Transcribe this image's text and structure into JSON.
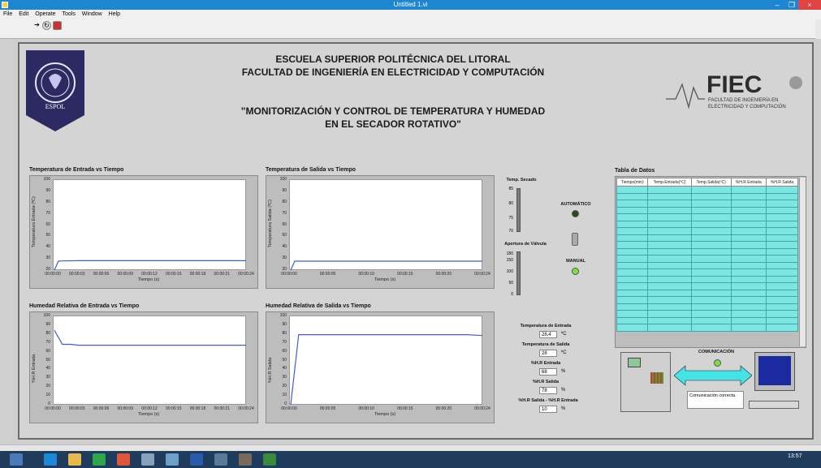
{
  "window": {
    "title": "Untitled 1.vi",
    "min": "–",
    "max": "❐",
    "close": "×"
  },
  "menu": [
    "File",
    "Edit",
    "Operate",
    "Tools",
    "Window",
    "Help"
  ],
  "header": {
    "line1": "ESCUELA SUPERIOR POLITÉCNICA DEL LITORAL",
    "line2": "FACULTAD DE INGENIERÍA EN ELECTRICIDAD Y COMPUTACIÓN",
    "line3": "\"MONITORIZACIÓN Y CONTROL DE TEMPERATURA Y HUMEDAD",
    "line4": "EN EL SECADOR ROTATIVO\""
  },
  "logo_right": {
    "brand": "FIEC",
    "sub1": "FACULTAD DE INGENIERÍA EN",
    "sub2": "ELECTRICIDAD Y COMPUTACIÓN"
  },
  "logo_left": {
    "label": "ESPOL"
  },
  "controls": {
    "temp_secado": "Temp. Secado",
    "apertura": "Apertura de Válvula",
    "automatico": "AUTOMÁTICO",
    "manual": "MANUAL",
    "temp_ticks": [
      "85",
      "80",
      "75",
      "70"
    ],
    "valve_ticks": [
      "180",
      "150",
      "100",
      "50",
      "0"
    ]
  },
  "indicators": {
    "t_entrada_label": "Temperatura de Entrada",
    "t_entrada": "28,4",
    "t_unit": "ºC",
    "t_salida_label": "Temperatura de Salida",
    "t_salida": "28",
    "hr_entrada_label": "%H.R Entrada",
    "hr_entrada": "68",
    "pct": "%",
    "hr_salida_label": "%H.R Salida",
    "hr_salida": "78",
    "diff_label": "%H.R Salida - %H.R Entrada",
    "diff": "10"
  },
  "table": {
    "title": "Tabla de Datos",
    "columns": [
      "Tiempo(min)",
      "Temp.Entrada(ºC)",
      "Temp.Salida(ºC)",
      "%H.R Entrada",
      "%H.R Salida"
    ]
  },
  "comm": {
    "label": "COMUNICACIÓN",
    "status": "Comunicación correcta"
  },
  "clock": {
    "time": "13:57"
  },
  "chart_data": [
    {
      "type": "line",
      "title": "Temperatura de Entrada vs Tiempo",
      "xlabel": "Tiempo (s)",
      "ylabel": "Temperatura Entrada (ºC)",
      "ylim": [
        20,
        100
      ],
      "yticks": [
        "100",
        "90",
        "80",
        "70",
        "60",
        "50",
        "40",
        "30",
        "20"
      ],
      "xticks": [
        "00:00:00",
        "00:00:03",
        "00:00:06",
        "00:00:09",
        "00:00:12",
        "00:00:15",
        "00:00:18",
        "00:00:21",
        "00:00:24"
      ],
      "series": [
        {
          "x": [
            0,
            0.5,
            1,
            3,
            24
          ],
          "y": [
            20,
            28,
            28.2,
            28.4,
            28.4
          ]
        }
      ],
      "color": "#3a5fd6"
    },
    {
      "type": "line",
      "title": "Temperatura de Salida vs Tiempo",
      "xlabel": "Tiempo (s)",
      "ylabel": "Temperatura Salida (ºC)",
      "ylim": [
        20,
        100
      ],
      "yticks": [
        "100",
        "90",
        "80",
        "70",
        "60",
        "50",
        "40",
        "30",
        "20"
      ],
      "xticks": [
        "00:00:00",
        "00:00:05",
        "00:00:10",
        "00:00:15",
        "00:00:20",
        "00:00:24"
      ],
      "series": [
        {
          "x": [
            0,
            0.5,
            1,
            24
          ],
          "y": [
            20,
            28,
            28,
            28
          ]
        }
      ],
      "color": "#3a5fd6"
    },
    {
      "type": "line",
      "title": "Humedad Relativa de Entrada vs Tiempo",
      "xlabel": "Tiempo (s)",
      "ylabel": "%H.R Entrada",
      "ylim": [
        0,
        100
      ],
      "yticks": [
        "100",
        "90",
        "80",
        "70",
        "60",
        "50",
        "40",
        "30",
        "20",
        "10",
        "0"
      ],
      "xticks": [
        "00:00:00",
        "00:00:03",
        "00:00:06",
        "00:00:09",
        "00:00:12",
        "00:00:15",
        "00:00:18",
        "00:00:21",
        "00:00:24"
      ],
      "series": [
        {
          "x": [
            0,
            1,
            2,
            3,
            24
          ],
          "y": [
            85,
            69,
            69,
            68,
            68
          ]
        }
      ],
      "color": "#3a5fd6"
    },
    {
      "type": "line",
      "title": "Humedad Relativa de Salida vs Tiempo",
      "xlabel": "Tiempo (s)",
      "ylabel": "%H.R Salida",
      "ylim": [
        0,
        100
      ],
      "yticks": [
        "100",
        "90",
        "80",
        "70",
        "60",
        "50",
        "40",
        "30",
        "20",
        "10",
        "0"
      ],
      "xticks": [
        "00:00:00",
        "00:00:05",
        "00:00:10",
        "00:00:15",
        "00:00:20",
        "00:00:24"
      ],
      "series": [
        {
          "x": [
            0,
            1,
            2,
            22,
            24
          ],
          "y": [
            0,
            80,
            80,
            80,
            79
          ]
        }
      ],
      "color": "#3a5fd6"
    }
  ]
}
